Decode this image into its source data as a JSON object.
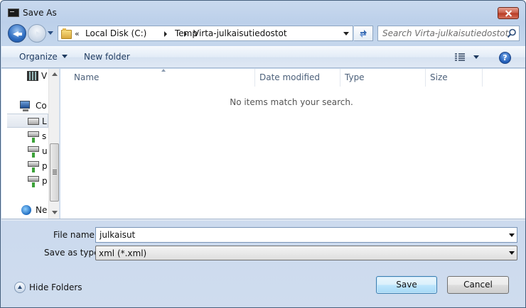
{
  "window": {
    "title": "Save As"
  },
  "address": {
    "overflow": "«",
    "crumbs": [
      "Local Disk (C:)",
      "Temp",
      "Virta-julkaisutiedostot"
    ]
  },
  "search": {
    "placeholder": "Search Virta-julkaisutiedostot"
  },
  "toolbar": {
    "organize_label": "Organize",
    "new_folder_label": "New folder",
    "help_label": "?"
  },
  "navpane": {
    "items": [
      {
        "label": "V",
        "icon": "video-icon"
      },
      {
        "label": "Co",
        "icon": "computer-icon"
      },
      {
        "label": "L",
        "icon": "disk-icon",
        "selected": true
      },
      {
        "label": "s",
        "icon": "network-drive-icon"
      },
      {
        "label": "u",
        "icon": "network-drive-icon"
      },
      {
        "label": "p",
        "icon": "network-drive-icon"
      },
      {
        "label": "p",
        "icon": "network-drive-icon"
      },
      {
        "label": "Ne",
        "icon": "network-icon"
      }
    ]
  },
  "columns": [
    "Name",
    "Date modified",
    "Type",
    "Size"
  ],
  "content": {
    "empty_message": "No items match your search."
  },
  "form": {
    "filename_label": "File name:",
    "filename_value": "julkaisut",
    "savetype_label": "Save as type:",
    "savetype_value": "xml (*.xml)"
  },
  "footer": {
    "hide_folders_label": "Hide Folders",
    "save_label": "Save",
    "cancel_label": "Cancel"
  },
  "colors": {
    "accent": "#3c7fb1",
    "close": "#c75a45",
    "chrome": "#c4d6ec"
  }
}
